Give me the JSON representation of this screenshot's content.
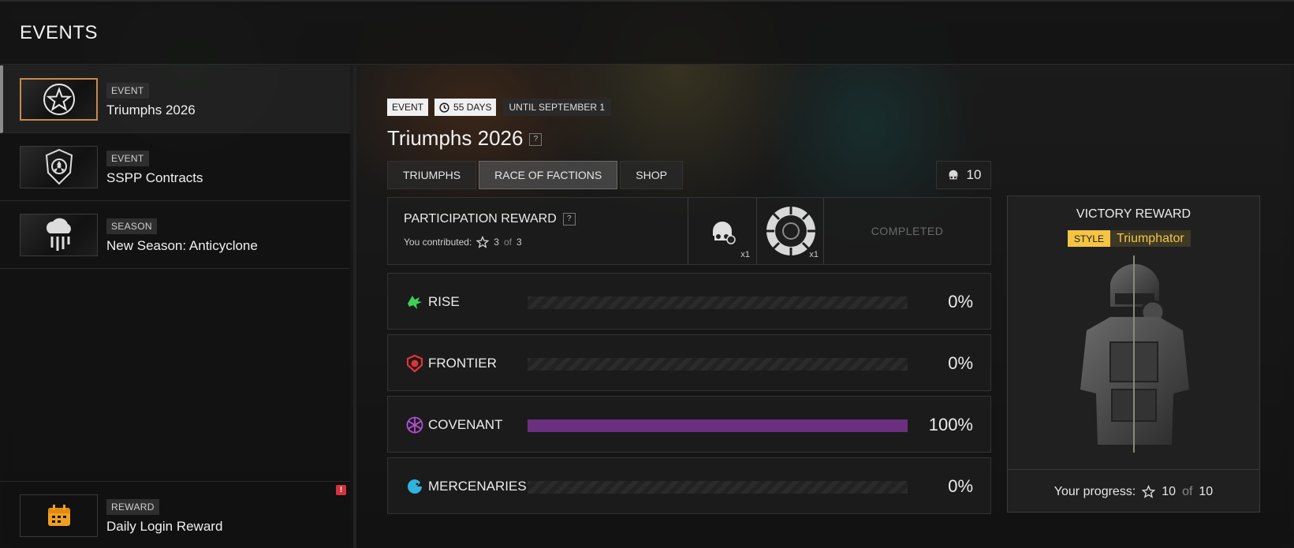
{
  "header": {
    "title": "EVENTS"
  },
  "sidebar": {
    "items": [
      {
        "tag": "EVENT",
        "name": "Triumphs 2026",
        "icon": "star-icon",
        "active": true
      },
      {
        "tag": "EVENT",
        "name": "SSPP Contracts",
        "icon": "radiation-shield-icon",
        "active": false
      },
      {
        "tag": "SEASON",
        "name": "New Season: Anticyclone",
        "icon": "storm-cloud-icon",
        "active": false
      }
    ],
    "daily": {
      "tag": "REWARD",
      "name": "Daily Login Reward",
      "icon": "calendar-icon",
      "alert": "!"
    }
  },
  "main": {
    "badges": {
      "type": "EVENT",
      "days": "55 DAYS",
      "until": "UNTIL SEPTEMBER 1"
    },
    "title": "Triumphs 2026",
    "help": "?",
    "tabs": [
      {
        "label": "TRIUMPHS",
        "active": false
      },
      {
        "label": "RACE OF FACTIONS",
        "active": true
      },
      {
        "label": "SHOP",
        "active": false
      }
    ],
    "points": "10",
    "participation": {
      "title": "PARTICIPATION REWARD",
      "help": "?",
      "contributed_label": "You contributed:",
      "contributed_value": "3",
      "of": "of",
      "contributed_total": "3",
      "rewards": [
        {
          "icon": "helmet-emblem-icon",
          "qty": "x1"
        },
        {
          "icon": "round-badge-icon",
          "qty": "x1"
        }
      ],
      "status": "COMPLETED"
    },
    "factions": [
      {
        "name": "RISE",
        "percent": "0%",
        "value": 0,
        "color": "#3ecf5a",
        "icon": "rise-dragon-icon"
      },
      {
        "name": "FRONTIER",
        "percent": "0%",
        "value": 0,
        "color": "#e0333a",
        "icon": "frontier-shield-icon"
      },
      {
        "name": "COVENANT",
        "percent": "100%",
        "value": 100,
        "color": "#6b2f80",
        "icon": "covenant-wheel-icon"
      },
      {
        "name": "MERCENARIES",
        "percent": "0%",
        "value": 0,
        "color": "#2fb4e0",
        "icon": "mercenaries-eagle-icon"
      }
    ],
    "victory": {
      "title": "VICTORY REWARD",
      "style_tag": "STYLE",
      "style_name": "Triumphator",
      "progress_label": "Your progress:",
      "progress_value": "10",
      "of": "of",
      "progress_total": "10"
    }
  }
}
